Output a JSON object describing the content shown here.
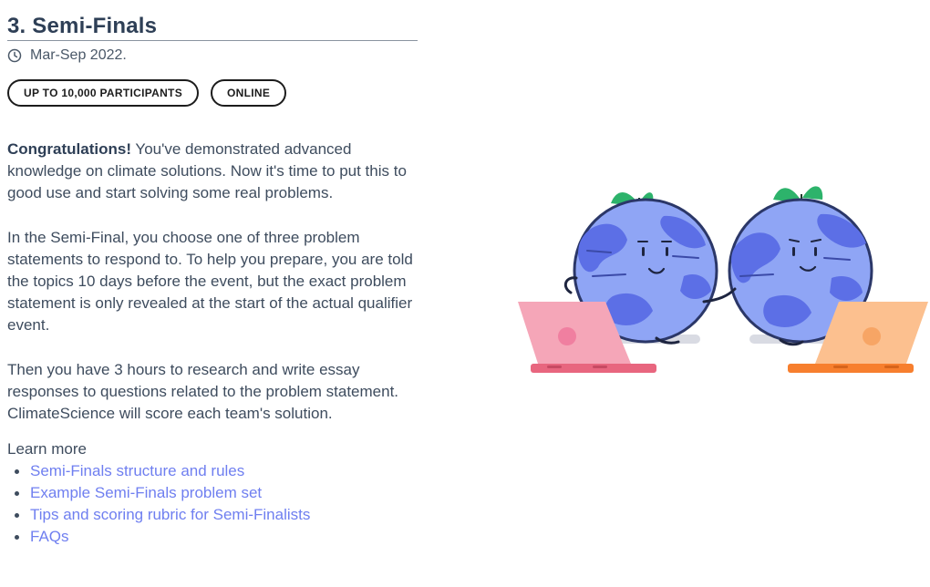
{
  "section": {
    "title": "3. Semi-Finals",
    "date": "Mar-Sep 2022.",
    "badges": [
      "UP TO 10,000 PARTICIPANTS",
      "ONLINE"
    ]
  },
  "body": {
    "p1_strong": "Congratulations!",
    "p1_rest": " You've demonstrated advanced knowledge on climate solutions. Now it's time to put this to good use and start solving some real problems.",
    "p2": "In the Semi-Final, you choose one of three problem statements to respond to. To help you prepare, you are told the topics 10 days before the event, but the exact problem statement is only revealed at the start of the actual qualifier event.",
    "p3": "Then you have 3 hours to research and write essay responses to questions related to the problem statement. ClimateScience will score each team's solution."
  },
  "learn_more": {
    "label": "Learn more",
    "links": [
      "Semi-Finals structure and rules",
      "Example Semi-Finals problem set",
      "Tips and scoring rubric for Semi-Finalists",
      "FAQs"
    ]
  },
  "colors": {
    "link": "#6f7ff0",
    "globe_base": "#8fa5f5",
    "globe_land": "#5c6fe6",
    "leaf": "#2db36b",
    "laptop_left": "#f5a6b8",
    "laptop_right": "#fcc08f"
  }
}
